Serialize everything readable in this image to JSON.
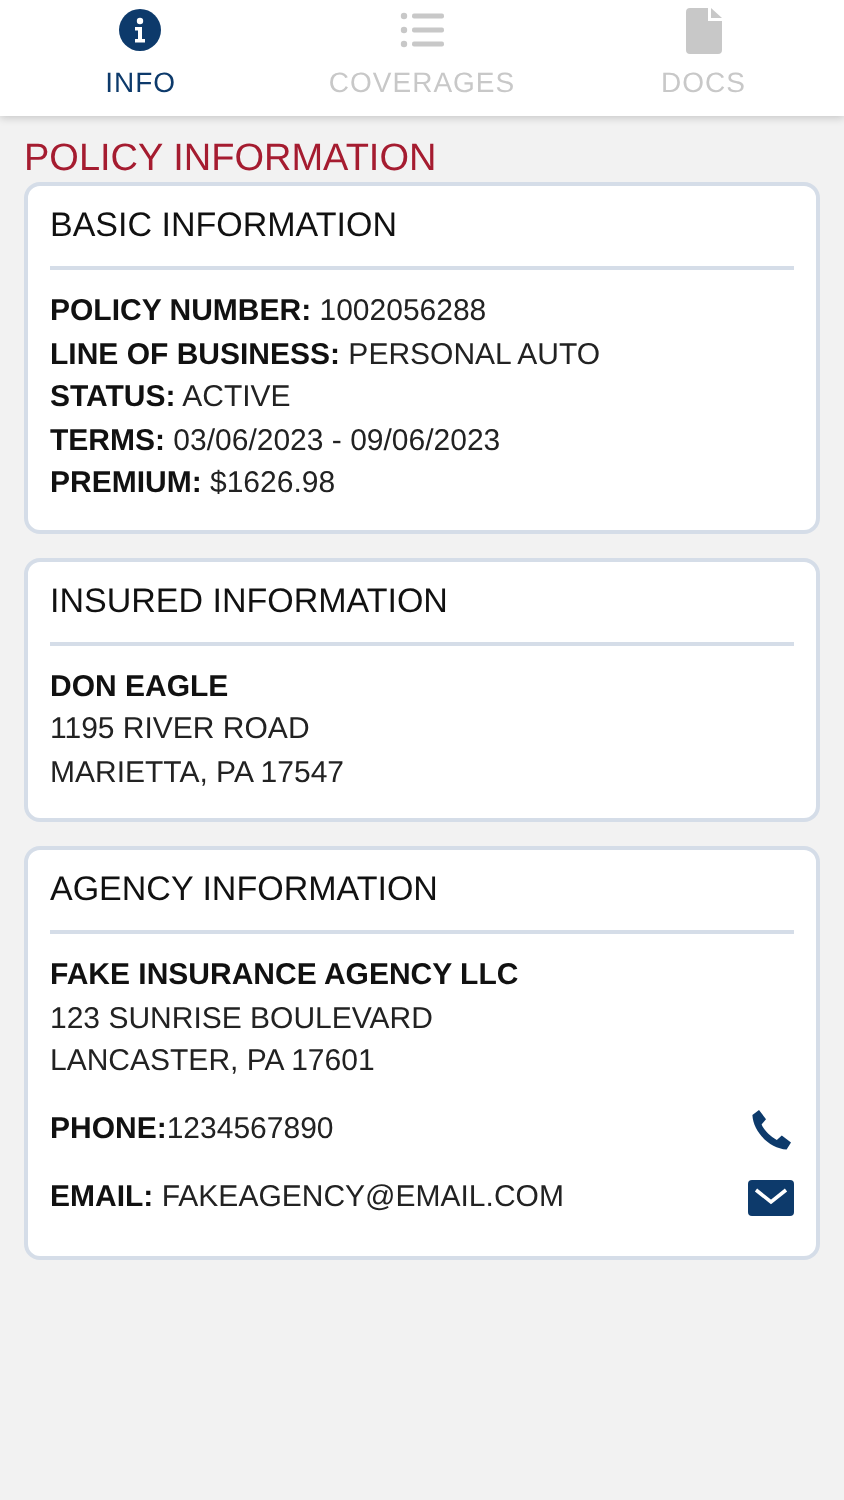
{
  "tabs": [
    {
      "label": "INFO",
      "kind": "info",
      "selected": true
    },
    {
      "label": "COVERAGES",
      "kind": "list",
      "selected": false
    },
    {
      "label": "DOCS",
      "kind": "doc",
      "selected": false
    }
  ],
  "page_title": "POLICY INFORMATION",
  "cards": [
    {
      "title": "BASIC INFORMATION",
      "lines": [
        {
          "kind": "field",
          "text": "**POLICY NUMBER:** 1002056288"
        },
        {
          "kind": "field",
          "text": "**LINE OF BUSINESS:** PERSONAL AUTO"
        },
        {
          "kind": "field",
          "text": "**STATUS:** ACTIVE"
        },
        {
          "kind": "field",
          "text": "**TERMS:** 03/06/2023 - 09/06/2023"
        },
        {
          "kind": "field",
          "text": "**PREMIUM:** $1626.98"
        }
      ]
    },
    {
      "title": "INSURED INFORMATION",
      "lines": [
        {
          "kind": "name",
          "text": "DON EAGLE"
        },
        {
          "kind": "address",
          "text": "1195 RIVER ROAD"
        },
        {
          "kind": "address",
          "text": "MARIETTA, PA 17547"
        }
      ]
    },
    {
      "title": "AGENCY INFORMATION",
      "lines": [
        {
          "kind": "name",
          "text": "FAKE INSURANCE AGENCY LLC"
        },
        {
          "kind": "address",
          "text": "123 SUNRISE BOULEVARD"
        },
        {
          "kind": "address",
          "text": "LANCASTER, PA 17601"
        },
        {
          "kind": "phone",
          "text": "**PHONE:**1234567890"
        },
        {
          "kind": "email",
          "text": "**EMAIL:** FAKEAGENCY@EMAIL.COM"
        }
      ]
    }
  ]
}
